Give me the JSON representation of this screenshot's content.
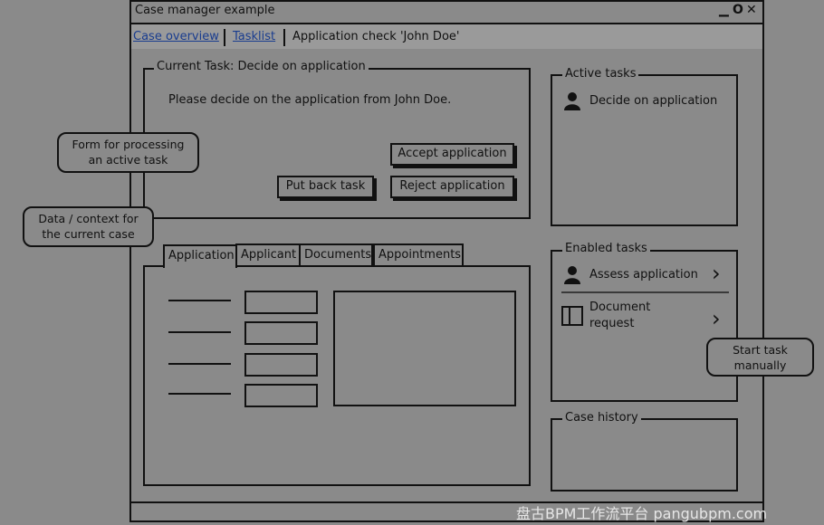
{
  "window": {
    "title": "Case manager example",
    "controls": {
      "minimize": "▁",
      "maximize": "O",
      "close": "✕"
    }
  },
  "nav": {
    "items": [
      "Case overview",
      "Tasklist"
    ],
    "current": "Application check 'John Doe'"
  },
  "current_task": {
    "legend": "Current Task: Decide on application",
    "message": "Please decide on the application from John Doe.",
    "buttons": {
      "accept": "Accept application",
      "put_back": "Put back task",
      "reject": "Reject application"
    }
  },
  "notes": {
    "form": [
      "Form for processing",
      "an active task"
    ],
    "data": [
      "Data / context for",
      "the current case"
    ],
    "start": [
      "Start task",
      "manually"
    ]
  },
  "tabs": [
    "Application",
    "Applicant",
    "Documents",
    "Appointments"
  ],
  "active_tasks": {
    "legend": "Active tasks",
    "items": [
      {
        "label": "Decide on application",
        "icon": "user-icon"
      }
    ]
  },
  "enabled_tasks": {
    "legend": "Enabled tasks",
    "items": [
      {
        "label": "Assess application",
        "icon": "user-icon"
      },
      {
        "label_line1": "Document",
        "label_line2": "request",
        "icon": "form-icon"
      }
    ],
    "chevron": "›"
  },
  "case_history": {
    "legend": "Case history"
  },
  "watermark": "盘古BPM工作流平台 pangubpm.com"
}
